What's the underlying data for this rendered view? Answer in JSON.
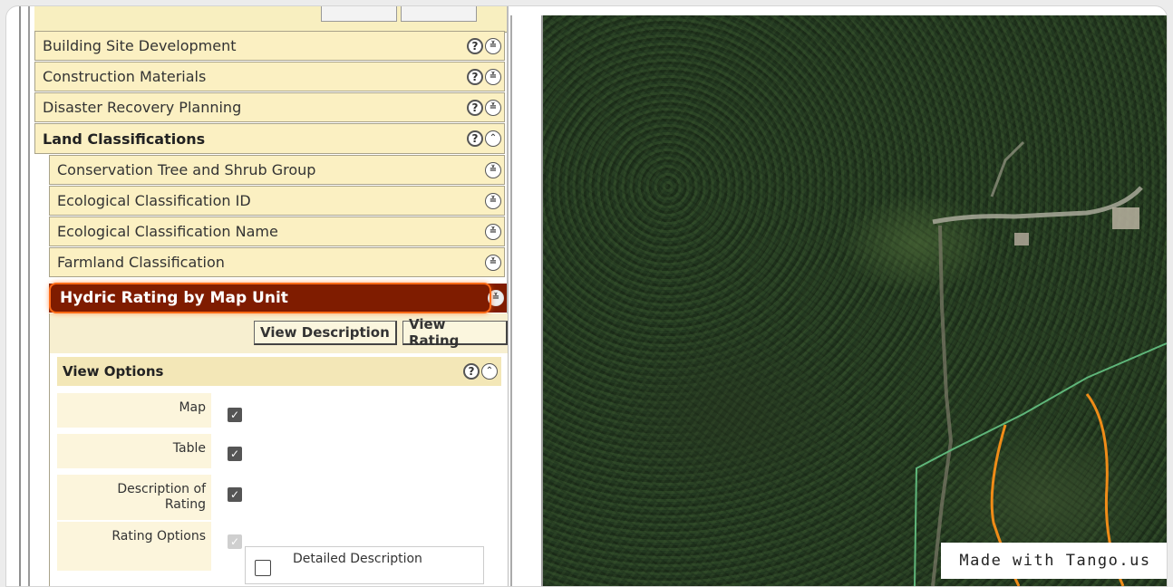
{
  "categories": [
    {
      "label": "Building Site Development",
      "help": "?",
      "toggle": "⌄⌄"
    },
    {
      "label": "Construction Materials",
      "help": "?",
      "toggle": "⌄⌄"
    },
    {
      "label": "Disaster Recovery Planning",
      "help": "?",
      "toggle": "⌄⌄"
    },
    {
      "label": "Land Classifications",
      "help": "?",
      "toggle": "⌃⌃"
    }
  ],
  "subitems": [
    {
      "label": "Conservation Tree and Shrub Group"
    },
    {
      "label": "Ecological Classification ID"
    },
    {
      "label": "Ecological Classification Name"
    },
    {
      "label": "Farmland Classification"
    }
  ],
  "active_item": {
    "label": "Hydric Rating by Map Unit"
  },
  "buttons": {
    "view_description": "View Description",
    "view_rating": "View Rating"
  },
  "view_options": {
    "title": "View Options",
    "map_label": "Map",
    "table_label": "Table",
    "description_label_1": "Description of",
    "description_label_2": "Rating",
    "rating_options_label": "Rating Options",
    "detailed_description_label": "Detailed Description"
  },
  "checks": {
    "map": true,
    "table": true,
    "description": true,
    "rating_options": true,
    "detailed_description": false
  },
  "watermark": "Made with Tango.us",
  "colors": {
    "active_row": "#7f1c00",
    "highlight": "#ff6a16",
    "row_bg": "#fbf0c2"
  }
}
